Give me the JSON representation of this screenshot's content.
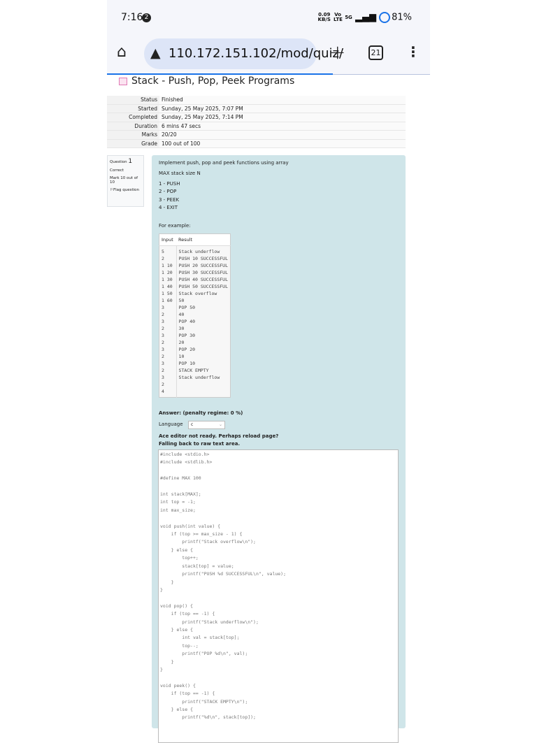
{
  "status_bar": {
    "time": "7:16",
    "notif_count": "2",
    "data_rate": "0.09",
    "data_unit": "KB/S",
    "volte": "Vo LTE",
    "network": "5G",
    "battery": "81%"
  },
  "browser": {
    "url": "110.172.151.102/mod/quiz/",
    "tab_count": "21",
    "page_load_progress": 0.7
  },
  "page": {
    "title": "Stack - Push, Pop, Peek Programs"
  },
  "summary": [
    {
      "label": "Status",
      "value": "Finished"
    },
    {
      "label": "Started",
      "value": "Sunday, 25 May 2025, 7:07 PM"
    },
    {
      "label": "Completed",
      "value": "Sunday, 25 May 2025, 7:14 PM"
    },
    {
      "label": "Duration",
      "value": "6 mins 47 secs"
    },
    {
      "label": "Marks",
      "value": "20/20"
    },
    {
      "label": "Grade",
      "value": "100 out of 100"
    }
  ],
  "question_info": {
    "label": "Question",
    "number": "1",
    "state": "Correct",
    "mark": "Mark 10 out of 10",
    "flag": "Flag question"
  },
  "question": {
    "intro": "Implement push, pop and peek functions using array",
    "max": "MAX stack size N",
    "options": [
      "1 - PUSH",
      "2 - POP",
      "3 - PEEK",
      "4 - EXIT"
    ],
    "example_label": "For example:",
    "example_headers": [
      "Input",
      "Result"
    ],
    "example_input": "5\n2\n1 10\n1 20\n1 30\n1 40\n1 50\n1 60\n3\n2\n3\n2\n3\n2\n3\n2\n3\n2\n3\n2\n4",
    "example_result": "Stack underflow\nPUSH 10 SUCCESSFUL\nPUSH 20 SUCCESSFUL\nPUSH 30 SUCCESSFUL\nPUSH 40 SUCCESSFUL\nPUSH 50 SUCCESSFUL\nStack overflow\n50\nPOP 50\n40\nPOP 40\n30\nPOP 30\n20\nPOP 20\n10\nPOP 10\nSTACK EMPTY\nStack underflow",
    "answer_label": "Answer:  (penalty regime: 0 %)",
    "language_label": "Language",
    "language_value": "c",
    "ace_msg1": "Ace editor not ready. Perhaps reload page?",
    "ace_msg2": "Falling back to raw text area.",
    "code": "#include <stdio.h>\n#include <stdlib.h>\n\n#define MAX 100\n\nint stack[MAX];\nint top = -1;\nint max_size;\n\nvoid push(int value) {\n    if (top >= max_size - 1) {\n        printf(\"Stack overflow\\n\");\n    } else {\n        top++;\n        stack[top] = value;\n        printf(\"PUSH %d SUCCESSFUL\\n\", value);\n    }\n}\n\nvoid pop() {\n    if (top == -1) {\n        printf(\"Stack underflow\\n\");\n    } else {\n        int val = stack[top];\n        top--;\n        printf(\"POP %d\\n\", val);\n    }\n}\n\nvoid peek() {\n    if (top == -1) {\n        printf(\"STACK EMPTY\\n\");\n    } else {\n        printf(\"%d\\n\", stack[top]);"
  }
}
